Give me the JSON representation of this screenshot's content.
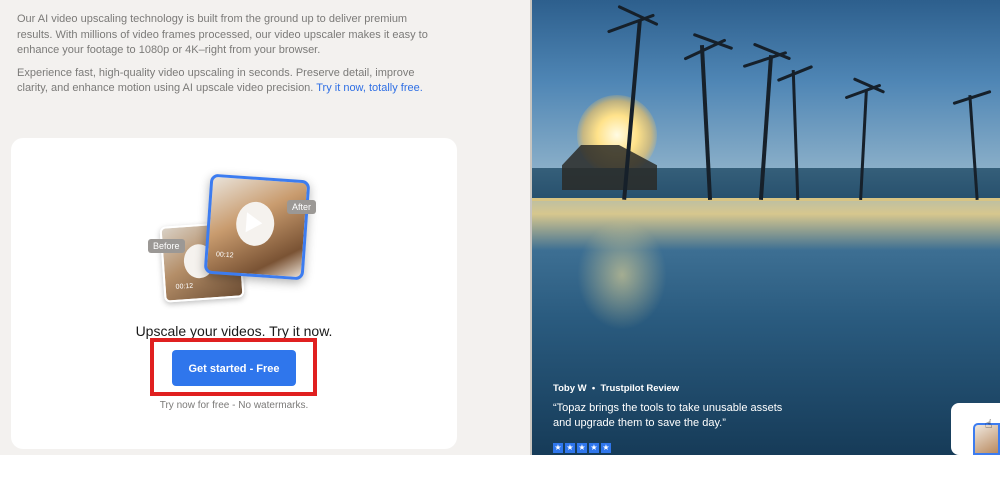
{
  "intro": {
    "paragraph1": "Our AI video upscaling technology is built from the ground up to deliver premium results. With millions of video frames processed, our video upscaler makes it easy to enhance your footage to 1080p or 4K–right from your browser.",
    "paragraph2": "Experience fast, high-quality video upscaling in seconds. Preserve detail, improve clarity, and enhance motion using AI upscale video precision.",
    "paragraph2_link": "Try it now, totally free."
  },
  "card": {
    "before_label": "Before",
    "after_label": "After",
    "before_time": "00:12",
    "after_time": "00:12",
    "title": "Upscale your videos. Try it now.",
    "cta_label": "Get started - Free",
    "subnote": "Try now for free - No watermarks."
  },
  "review": {
    "author": "Toby W",
    "separator": "•",
    "source": "Trustpilot Review",
    "quote": "“Topaz brings the tools to take unusable assets and upgrade them to save the day.”",
    "rating": 5
  },
  "colors": {
    "accent": "#2f76ec",
    "highlight": "#e02020",
    "link": "#2f6fe4"
  }
}
